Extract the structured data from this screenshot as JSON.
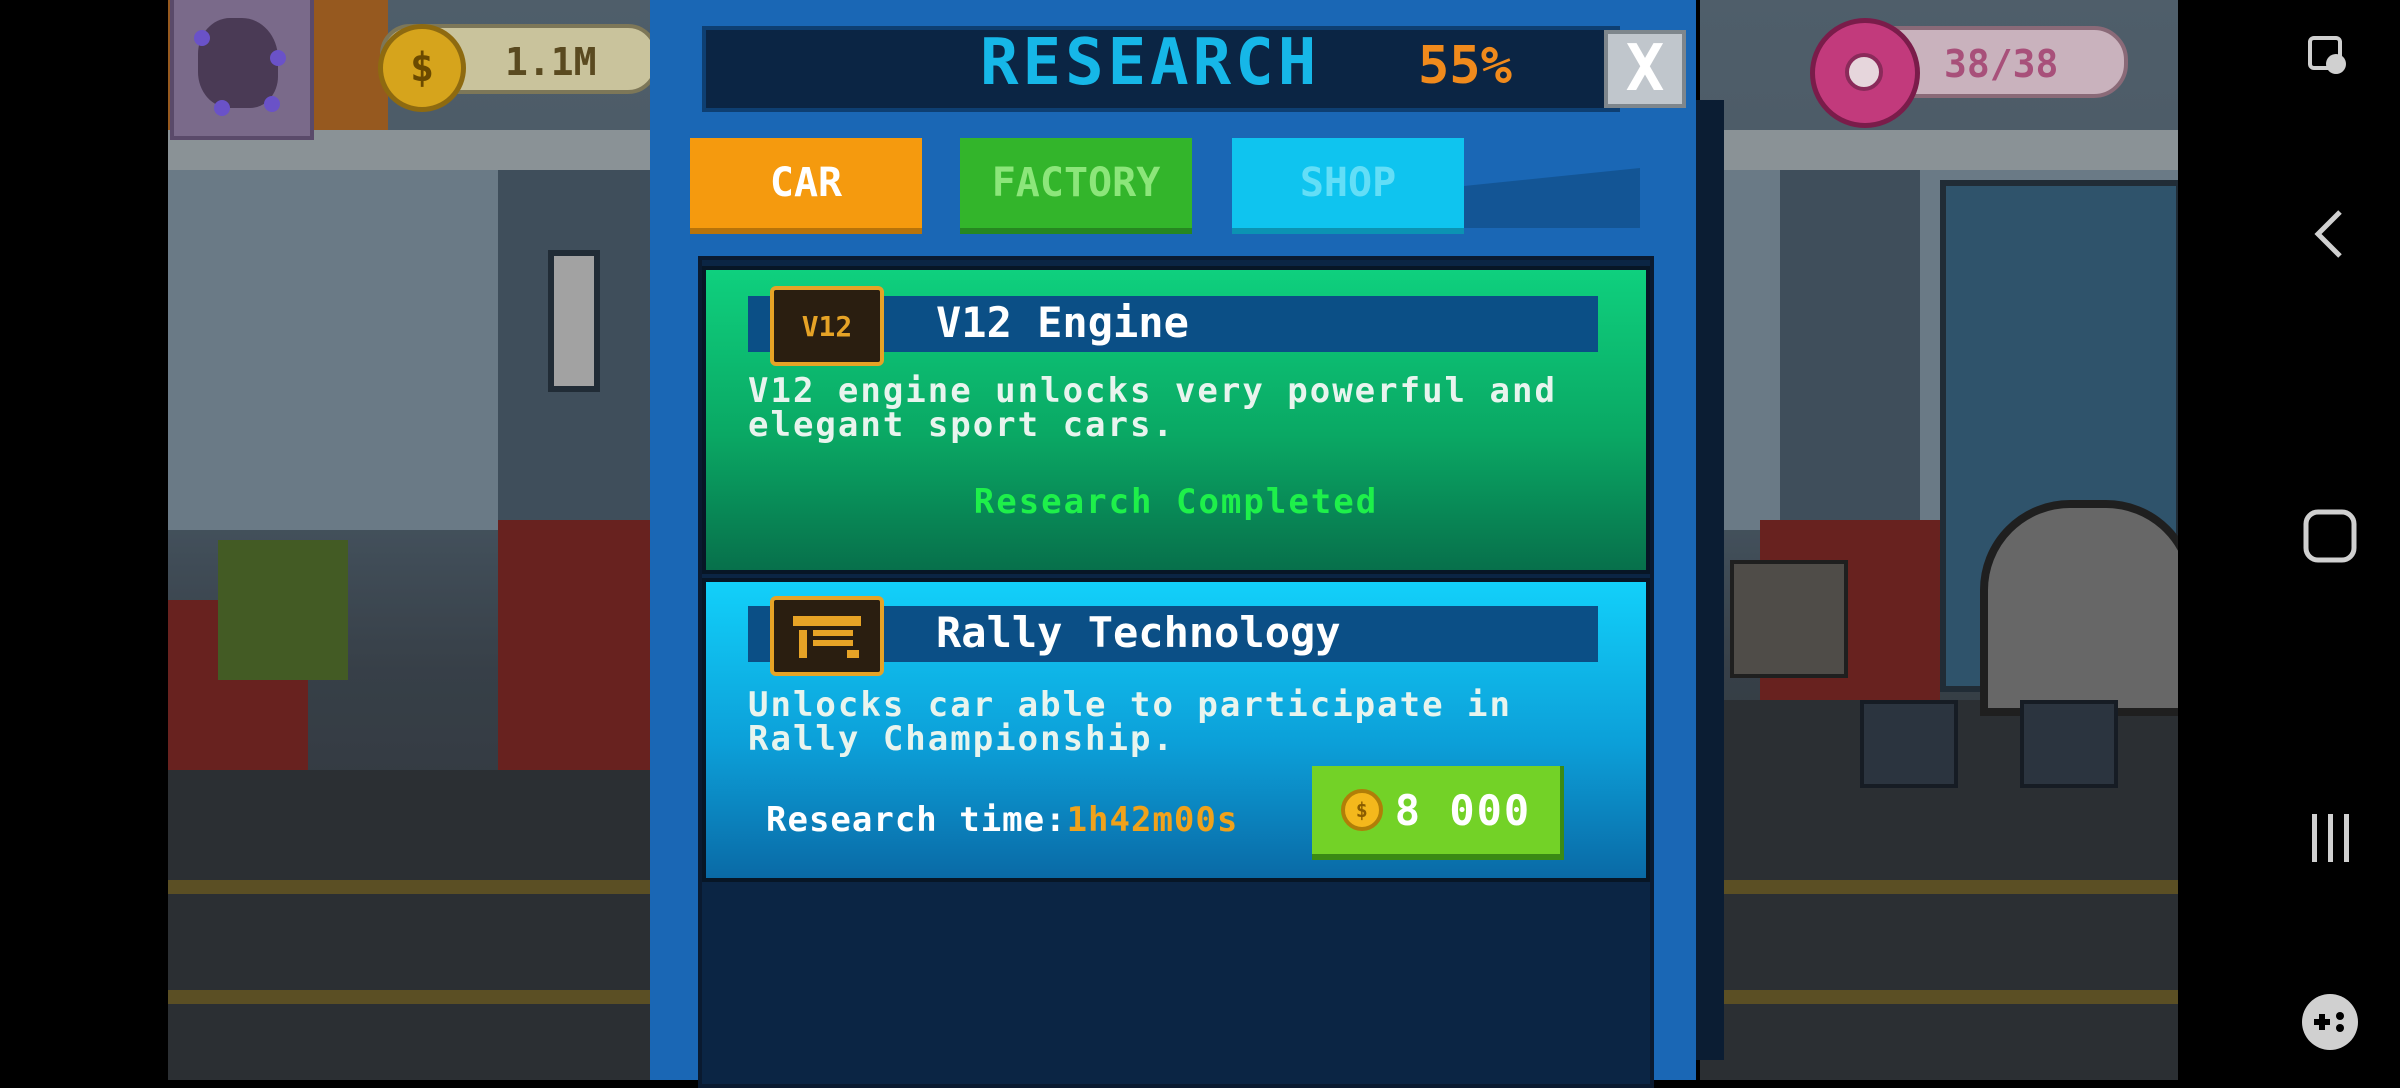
{
  "hud": {
    "money_value": "1.1M",
    "coin_icon": "dollar-coin-icon",
    "donut_value": "38/38",
    "donut_icon": "donut-icon"
  },
  "research": {
    "title": "RESEARCH",
    "percent": "55%",
    "close_label": "X",
    "tabs": [
      {
        "label": "CAR",
        "active": true
      },
      {
        "label": "FACTORY",
        "active": false
      },
      {
        "label": "SHOP",
        "active": false
      }
    ],
    "items": [
      {
        "title": "V12 Engine",
        "icon": "v12-engine-icon",
        "icon_text": "V12",
        "description": "V12 engine unlocks very powerful and elegant sport cars.",
        "status": "Research Completed"
      },
      {
        "title": "Rally Technology",
        "icon": "rally-flag-icon",
        "description": "Unlocks car able to participate in Rally Championship.",
        "research_time_label": "Research time:",
        "research_time_value": "1h42m00s",
        "price": "8 000",
        "price_icon": "coin-icon"
      }
    ]
  },
  "colors": {
    "modal_bg": "#1a67b5",
    "title_cyan": "#16b7e8",
    "percent_orange": "#f08a1c",
    "tab_car": "#f59a0e",
    "tab_factory": "#33b52b",
    "tab_shop": "#0fc4ef",
    "card_green": "#0aa864",
    "card_blue": "#0c9fd8",
    "completed_green": "#1ef04a",
    "buy_green": "#73d227"
  },
  "system_nav": {
    "icons": [
      "screen-assist-icon",
      "back-icon",
      "home-icon",
      "recents-icon",
      "game-tools-icon"
    ]
  }
}
